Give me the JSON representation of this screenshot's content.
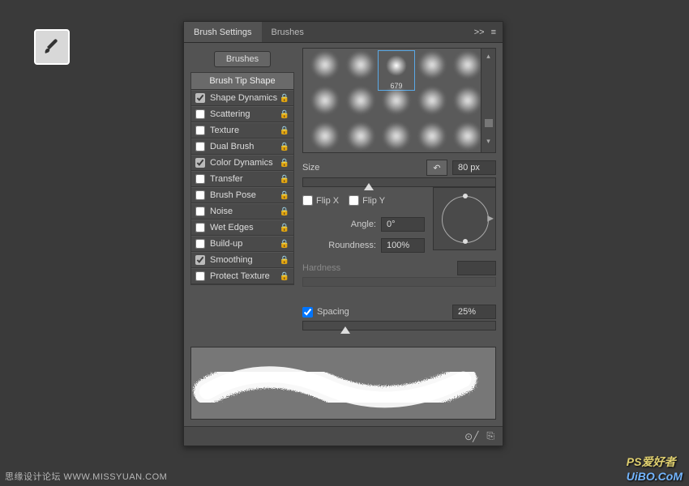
{
  "tool_icon": "brush-tool",
  "header": {
    "tabs": [
      {
        "label": "Brush Settings",
        "active": true
      },
      {
        "label": "Brushes",
        "active": false
      }
    ],
    "collapse_icon": ">>",
    "menu_icon": "≡"
  },
  "brushes_button": "Brushes",
  "options_header": "Brush Tip Shape",
  "options": [
    {
      "label": "Shape Dynamics",
      "checked": true,
      "locked": true
    },
    {
      "label": "Scattering",
      "checked": false,
      "locked": true
    },
    {
      "label": "Texture",
      "checked": false,
      "locked": true
    },
    {
      "label": "Dual Brush",
      "checked": false,
      "locked": true
    },
    {
      "label": "Color Dynamics",
      "checked": true,
      "locked": true
    },
    {
      "label": "Transfer",
      "checked": false,
      "locked": true
    },
    {
      "label": "Brush Pose",
      "checked": false,
      "locked": true
    },
    {
      "label": "Noise",
      "checked": false,
      "locked": true
    },
    {
      "label": "Wet Edges",
      "checked": false,
      "locked": true
    },
    {
      "label": "Build-up",
      "checked": false,
      "locked": true
    },
    {
      "label": "Smoothing",
      "checked": true,
      "locked": true
    },
    {
      "label": "Protect Texture",
      "checked": false,
      "locked": true
    }
  ],
  "brush_grid": {
    "selected_label": "679",
    "selected_pos": {
      "col": 2,
      "row": 0
    }
  },
  "size": {
    "label": "Size",
    "value": "80 px",
    "slider_pct": 34
  },
  "flip": {
    "x_label": "Flip X",
    "x_checked": false,
    "y_label": "Flip Y",
    "y_checked": false
  },
  "angle": {
    "label": "Angle:",
    "value": "0°"
  },
  "roundness": {
    "label": "Roundness:",
    "value": "100%"
  },
  "hardness": {
    "label": "Hardness"
  },
  "spacing": {
    "label": "Spacing",
    "checked": true,
    "value": "25%",
    "slider_pct": 22
  },
  "footer": {
    "toggle_icon": "⊙╱",
    "new_icon": "⎘"
  },
  "watermarks": {
    "left": "思缘设计论坛  WWW.MISSYUAN.COM",
    "right_prefix": "PS爱好者",
    "right_url": "UiBO.CoM"
  }
}
